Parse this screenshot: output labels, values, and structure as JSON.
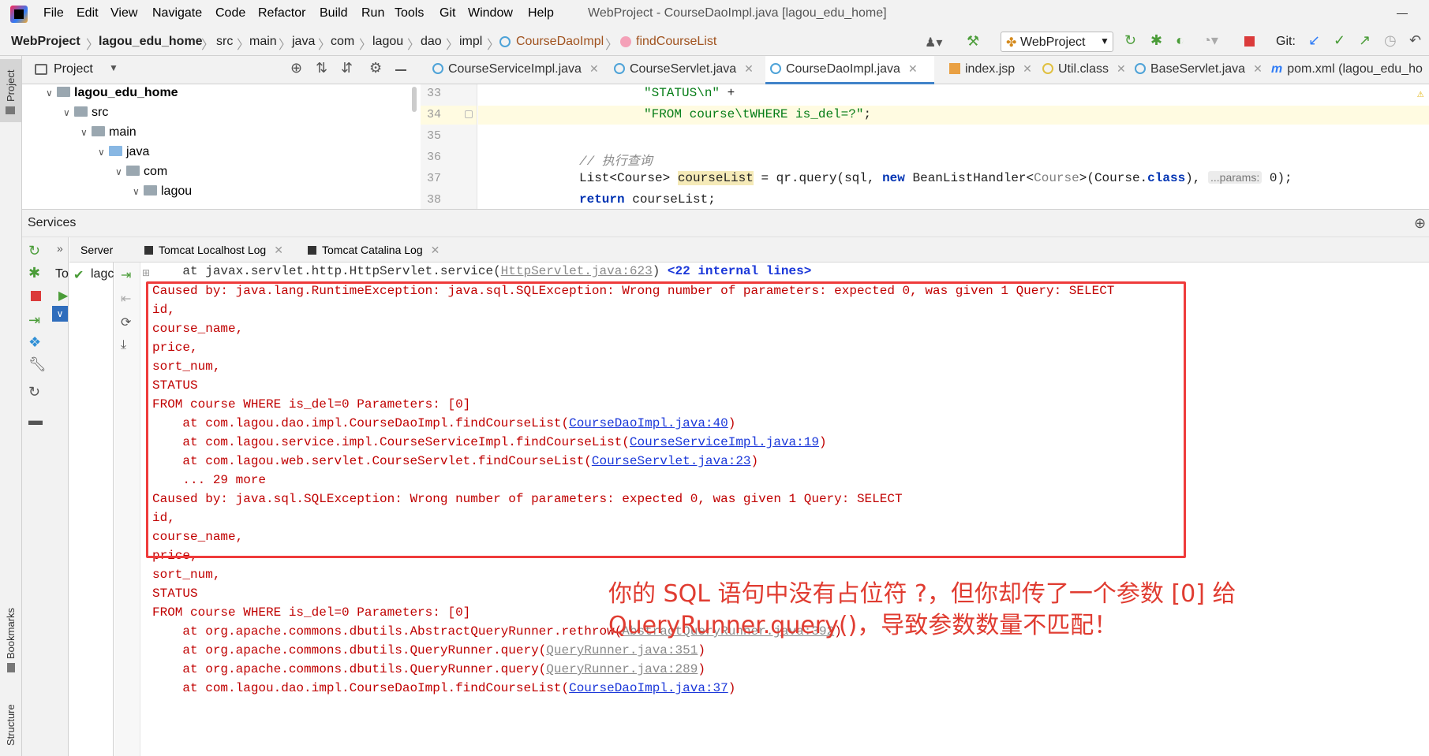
{
  "menu": {
    "items": [
      "File",
      "Edit",
      "View",
      "Navigate",
      "Code",
      "Refactor",
      "Build",
      "Run",
      "Tools",
      "Git",
      "Window",
      "Help"
    ],
    "window_title": "WebProject - CourseDaoImpl.java [lagou_edu_home]"
  },
  "breadcrumb": {
    "items": [
      "WebProject",
      "lagou_edu_home",
      "src",
      "main",
      "java",
      "com",
      "lagou",
      "dao",
      "impl",
      "CourseDaoImpl",
      "findCourseList"
    ]
  },
  "toolbar": {
    "run_config": "WebProject",
    "git_label": "Git:"
  },
  "project_panel": {
    "title": "Project",
    "tree": [
      "lagou_edu_home",
      "src",
      "main",
      "java",
      "com",
      "lagou"
    ]
  },
  "editor_tabs": [
    "CourseServiceImpl.java",
    "CourseServlet.java",
    "CourseDaoImpl.java",
    "index.jsp",
    "Util.class",
    "BaseServlet.java",
    "pom.xml (lagou_edu_ho"
  ],
  "editor": {
    "line_numbers": [
      "33",
      "34",
      "35",
      "36",
      "37",
      "38"
    ],
    "lines": {
      "l33_str": "\"STATUS\\n\"",
      "l33_rest": " +",
      "l34_str": "\"FROM course\\tWHERE is_del=?\"",
      "l34_rest": ";",
      "l36_comment": "// 执行查询",
      "l37_a": "List<Course> ",
      "l37_var": "courseList",
      "l37_b": " = qr.query(sql, ",
      "l37_new": "new",
      "l37_c": " BeanListHandler<",
      "l37_generic": "Course",
      "l37_d": ">(Course.",
      "l37_class": "class",
      "l37_e": "), ",
      "l37_hint": "...params:",
      "l37_f": " 0);",
      "l38_return": "return",
      "l38_rest": " courseList;"
    }
  },
  "services": {
    "title": "Services",
    "log_tabs": [
      "Server",
      "Tomcat Localhost Log",
      "Tomcat Catalina Log"
    ],
    "server_col": [
      "To",
      "lagc"
    ]
  },
  "console": {
    "line0_a": "    at javax.servlet.http.HttpServlet.service(",
    "line0_link": "HttpServlet.java:623",
    "line0_b": ") ",
    "line0_c": "<22 internal lines>",
    "l1": "Caused by: java.lang.RuntimeException: java.sql.SQLException: Wrong number of parameters: expected 0, was given 1 Query: SELECT",
    "l2": "id,",
    "l3": "course_name,",
    "l4": "price,",
    "l5": "sort_num,",
    "l6": "STATUS",
    "l7": "FROM course WHERE is_del=0 Parameters: [0]",
    "l8_a": "    at com.lagou.dao.impl.CourseDaoImpl.findCourseList(",
    "l8_link": "CourseDaoImpl.java:40",
    "l8_b": ")",
    "l9_a": "    at com.lagou.service.impl.CourseServiceImpl.findCourseList(",
    "l9_link": "CourseServiceImpl.java:19",
    "l9_b": ")",
    "l10_a": "    at com.lagou.web.servlet.CourseServlet.findCourseList(",
    "l10_link": "CourseServlet.java:23",
    "l10_b": ")",
    "l11": "    ... 29 more",
    "l12": "Caused by: java.sql.SQLException: Wrong number of parameters: expected 0, was given 1 Query: SELECT",
    "l13": "id,",
    "l14": "course_name,",
    "l15": "price,",
    "l16": "sort_num,",
    "l17": "STATUS",
    "l18": "FROM course WHERE is_del=0 Parameters: [0]",
    "l19_a": "    at org.apache.commons.dbutils.AbstractQueryRunner.rethrow(",
    "l19_link": "AbstractQueryRunner.java:392",
    "l19_b": ")",
    "l20_a": "    at org.apache.commons.dbutils.QueryRunner.query(",
    "l20_link": "QueryRunner.java:351",
    "l20_b": ")",
    "l21_a": "    at org.apache.commons.dbutils.QueryRunner.query(",
    "l21_link": "QueryRunner.java:289",
    "l21_b": ")",
    "l22_a": "    at com.lagou.dao.impl.CourseDaoImpl.findCourseList(",
    "l22_link": "CourseDaoImpl.java:37",
    "l22_b": ")"
  },
  "annotation": {
    "line1": "你的 SQL 语句中没有占位符 ?，但你却传了一个参数 [0] 给",
    "line2": "QueryRunner.query()，导致参数数量不匹配！"
  },
  "side_labels": {
    "project": "Project",
    "bookmarks": "Bookmarks",
    "structure": "Structure"
  },
  "colors": {
    "error_text": "#c00000",
    "annotation": "#e03c31",
    "highlight_box": "#ef3b3b",
    "link": "#1a37d9"
  }
}
